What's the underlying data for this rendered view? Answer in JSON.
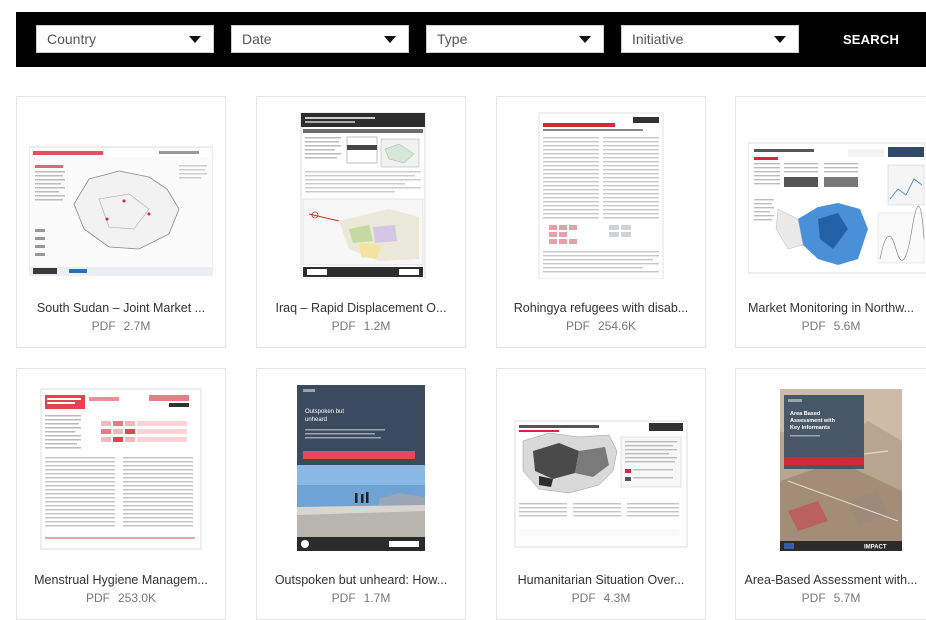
{
  "filters": {
    "country_label": "Country",
    "date_label": "Date",
    "type_label": "Type",
    "initiative_label": "Initiative",
    "search_label": "SEARCH"
  },
  "documents": [
    {
      "title": "South Sudan – Joint Market ...",
      "format": "PDF",
      "size": "2.7M",
      "thumb": "map-report",
      "accent": "#d9263d"
    },
    {
      "title": "Iraq – Rapid Displacement O...",
      "format": "PDF",
      "size": "1.2M",
      "thumb": "displacement-overview",
      "accent": "#333333"
    },
    {
      "title": "Rohingya refugees with disab...",
      "format": "PDF",
      "size": "254.6K",
      "thumb": "text-report",
      "accent": "#d9263d"
    },
    {
      "title": "Market Monitoring in Northw...",
      "format": "PDF",
      "size": "5.6M",
      "thumb": "market-map",
      "accent": "#2f7fd1"
    },
    {
      "title": "Menstrual Hygiene Managem...",
      "format": "PDF",
      "size": "253.0K",
      "thumb": "hygiene-report",
      "accent": "#e3454e"
    },
    {
      "title": "Outspoken but unheard: How...",
      "format": "PDF",
      "size": "1.7M",
      "thumb": "photo-cover",
      "accent": "#3b4a5e"
    },
    {
      "title": "Humanitarian Situation Over...",
      "format": "PDF",
      "size": "4.3M",
      "thumb": "grey-map",
      "accent": "#d9263d"
    },
    {
      "title": "Area-Based Assessment with...",
      "format": "PDF",
      "size": "5.7M",
      "thumb": "satellite-cover",
      "accent": "#d9263d"
    }
  ],
  "cover_text": {
    "card6_lines": [
      "Outspoken but",
      "unheard"
    ],
    "card8_lines": [
      "Area Based",
      "Assessment with",
      "Key Informants"
    ],
    "impact": "IMPACT",
    "reach": "REACH"
  }
}
